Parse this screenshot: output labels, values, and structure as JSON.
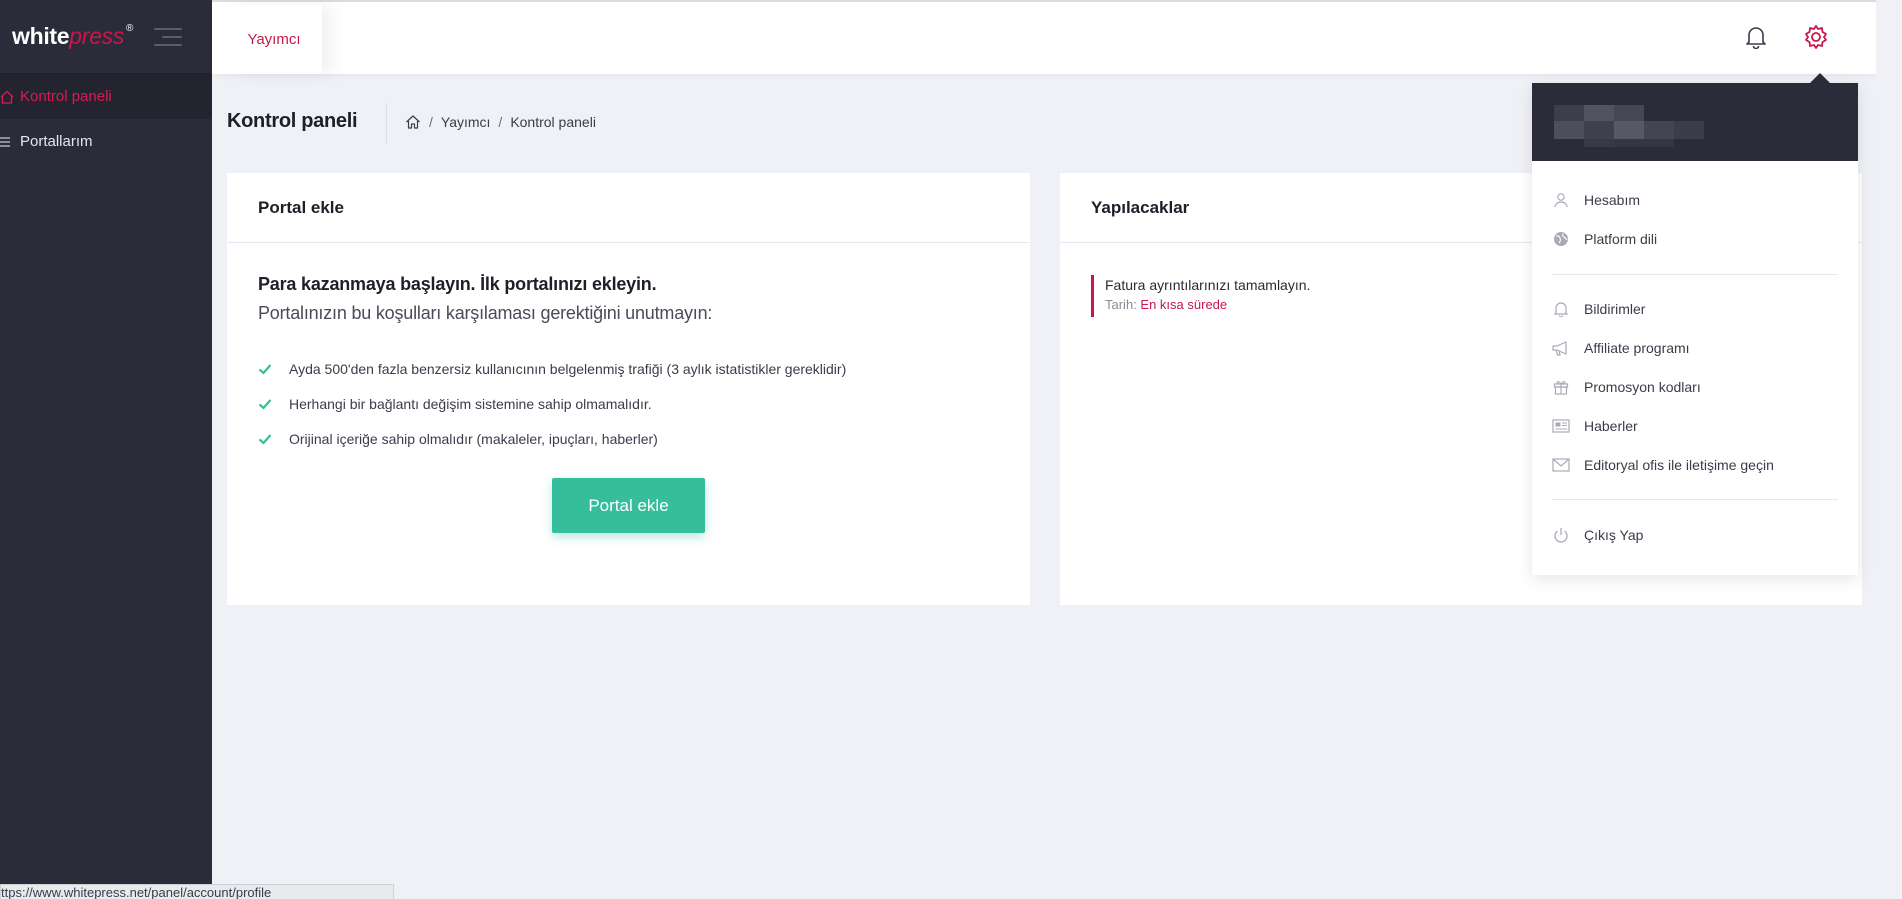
{
  "logo": {
    "white": "white",
    "press": "press",
    "reg": "®"
  },
  "sidebar": {
    "items": [
      {
        "label": "Kontrol paneli",
        "icon": "home-icon",
        "active": true
      },
      {
        "label": "Portallarım",
        "icon": "list-icon",
        "active": false
      }
    ]
  },
  "topbar": {
    "tab": "Yayımcı",
    "icons": [
      "bell-icon",
      "gear-icon"
    ]
  },
  "page": {
    "title": "Kontrol paneli",
    "breadcrumb": [
      "Yayımcı",
      "Kontrol paneli"
    ]
  },
  "card_portal": {
    "title": "Portal ekle",
    "lead": "Para kazanmaya başlayın. İlk portalınızı ekleyin.",
    "sub": "Portalınızın bu koşulları karşılaması gerektiğini unutmayın:",
    "requirements": [
      "Ayda 500'den fazla benzersiz kullanıcının belgelenmiş trafiği (3 aylık istatistikler gereklidir)",
      "Herhangi bir bağlantı değişim sistemine sahip olmamalıdır.",
      "Orijinal içeriğe sahip olmalıdır (makaleler, ipuçları, haberler)"
    ],
    "button": "Portal ekle"
  },
  "card_todo": {
    "title": "Yapılacaklar",
    "item_text": "Fatura ayrıntılarınızı tamamlayın.",
    "date_label": "Tarih:",
    "date_value": "En kısa sürede"
  },
  "dropdown": {
    "group1": [
      {
        "label": "Hesabım",
        "icon": "user-icon"
      },
      {
        "label": "Platform dili",
        "icon": "globe-icon"
      }
    ],
    "group2": [
      {
        "label": "Bildirimler",
        "icon": "bell-icon"
      },
      {
        "label": "Affiliate programı",
        "icon": "megaphone-icon"
      },
      {
        "label": "Promosyon kodları",
        "icon": "gift-icon"
      },
      {
        "label": "Haberler",
        "icon": "newspaper-icon"
      },
      {
        "label": "Editoryal ofis ile iletişime geçin",
        "icon": "mail-icon"
      }
    ],
    "logout": {
      "label": "Çıkış Yap",
      "icon": "power-icon"
    }
  },
  "status_url": "ttps://www.whitepress.net/panel/account/profile",
  "colors": {
    "accent": "#c8174a",
    "green": "#35bd9c",
    "sidebar": "#2b2c3a"
  }
}
